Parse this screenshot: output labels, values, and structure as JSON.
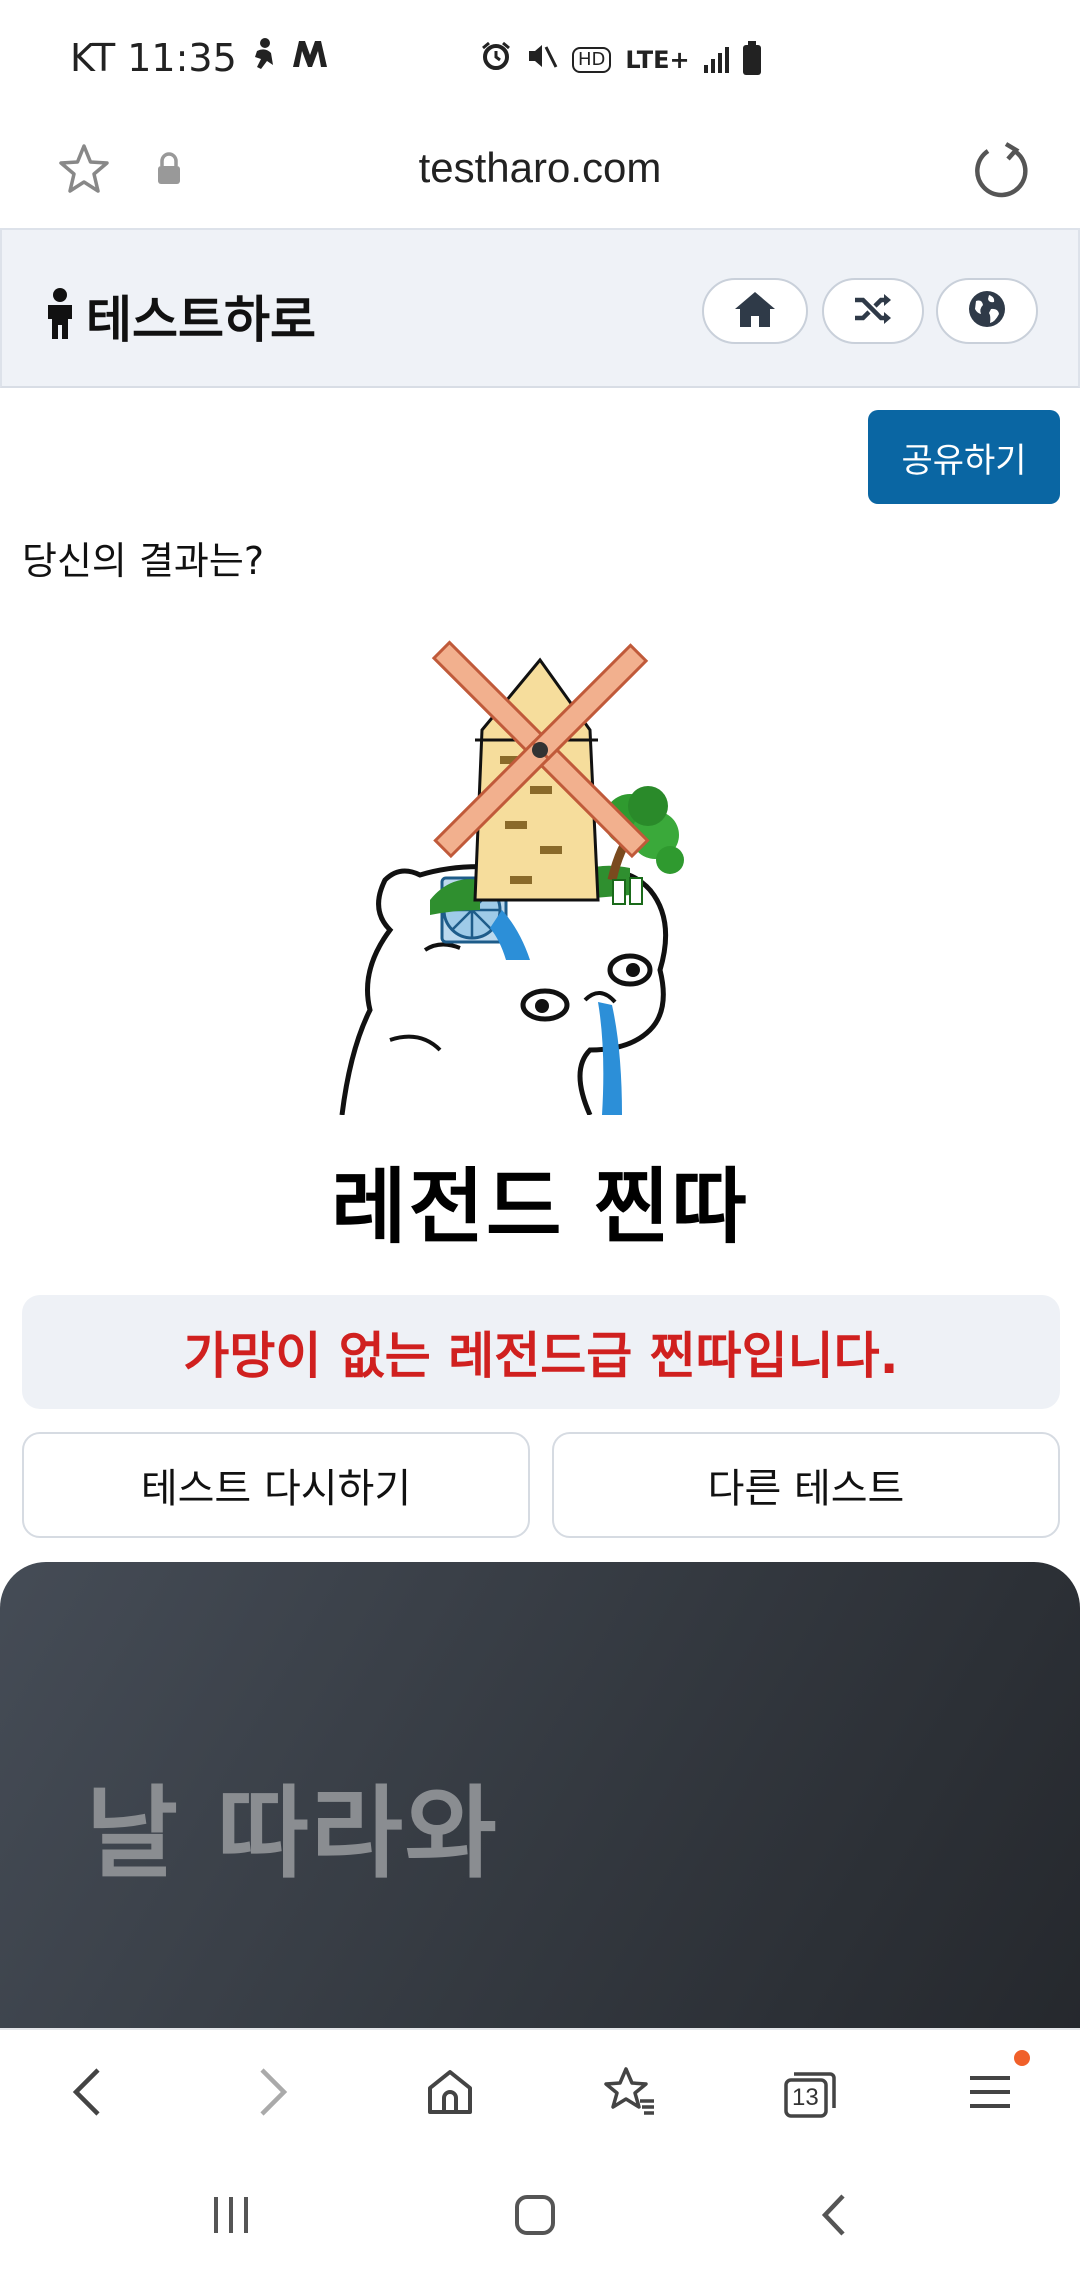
{
  "status_bar": {
    "carrier_time": "KT 11:35",
    "network_label": "LTE+",
    "hd_label": "HD",
    "icons": [
      "person-icon",
      "m-icon",
      "alarm-icon",
      "mute-icon",
      "hd-icon",
      "lte-icon",
      "signal-icon",
      "battery-icon"
    ]
  },
  "browser": {
    "url": "testharo.com",
    "icons": [
      "star-icon",
      "lock-icon",
      "reload-icon"
    ]
  },
  "site_header": {
    "logo_text": "테스트하로",
    "nav_icons": [
      "home-icon",
      "shuffle-icon",
      "globe-icon"
    ]
  },
  "share_label": "공유하기",
  "result_prompt": "당신의 결과는?",
  "result_title": "레전드 찐따",
  "result_description": "가망이 없는 레전드급 찐따입니다.",
  "actions": {
    "retry_label": "테스트 다시하기",
    "other_label": "다른 테스트"
  },
  "promo_text": "날 따라와",
  "toolbar": {
    "tab_count": "13",
    "icons": [
      "back-icon",
      "forward-icon",
      "home-icon",
      "bookmarks-icon",
      "tabs-icon",
      "menu-icon"
    ]
  },
  "system_nav": {
    "icons": [
      "recents-icon",
      "home-icon",
      "back-icon"
    ]
  },
  "colors": {
    "share_button": "#0a66a3",
    "description_text": "#d0201f",
    "header_bg": "#eff2f7",
    "promo_bg": "#33383f",
    "notification_dot": "#f0602a"
  }
}
